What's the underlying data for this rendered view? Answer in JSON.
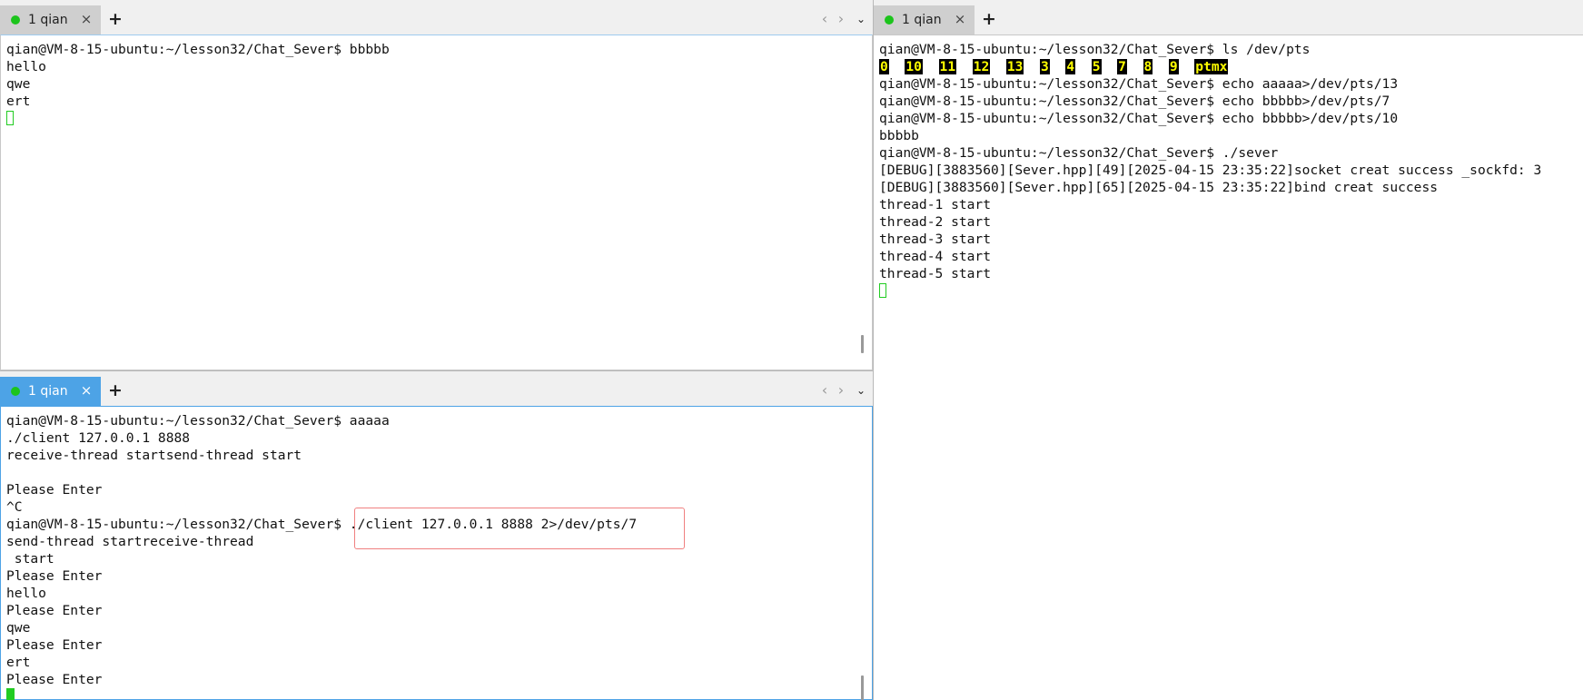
{
  "panes": {
    "top_left": {
      "tab_label": "1 qian",
      "lines": [
        "qian@VM-8-15-ubuntu:~/lesson32/Chat_Sever$ bbbbb",
        "hello",
        "qwe",
        "ert"
      ]
    },
    "bottom_left": {
      "tab_label": "1 qian",
      "lines": [
        "qian@VM-8-15-ubuntu:~/lesson32/Chat_Sever$ aaaaa",
        "./client 127.0.0.1 8888",
        "receive-thread startsend-thread start",
        "",
        "Please Enter",
        "^C",
        "qian@VM-8-15-ubuntu:~/lesson32/Chat_Sever$ ./client 127.0.0.1 8888 2>/dev/pts/7",
        "send-thread startreceive-thread",
        " start",
        "Please Enter",
        "hello",
        "Please Enter",
        "qwe",
        "Please Enter",
        "ert",
        "Please Enter"
      ]
    },
    "right": {
      "tab_label": "1 qian",
      "line_ls_cmd": "qian@VM-8-15-ubuntu:~/lesson32/Chat_Sever$ ls /dev/pts",
      "ls_items": [
        "0",
        "10",
        "11",
        "12",
        "13",
        "3",
        "4",
        "5",
        "7",
        "8",
        "9",
        "ptmx"
      ],
      "lines": [
        "qian@VM-8-15-ubuntu:~/lesson32/Chat_Sever$ echo aaaaa>/dev/pts/13",
        "qian@VM-8-15-ubuntu:~/lesson32/Chat_Sever$ echo bbbbb>/dev/pts/7",
        "qian@VM-8-15-ubuntu:~/lesson32/Chat_Sever$ echo bbbbb>/dev/pts/10",
        "bbbbb",
        "qian@VM-8-15-ubuntu:~/lesson32/Chat_Sever$ ./sever",
        "[DEBUG][3883560][Sever.hpp][49][2025-04-15 23:35:22]socket creat success _sockfd: 3",
        "[DEBUG][3883560][Sever.hpp][65][2025-04-15 23:35:22]bind creat success",
        "thread-1 start",
        "thread-2 start",
        "thread-3 start",
        "thread-4 start",
        "thread-5 start"
      ]
    }
  },
  "icons": {
    "close": "×",
    "add": "+",
    "prev": "‹",
    "next": "›",
    "dropdown": "⌄"
  },
  "colors": {
    "active_tab": "#4da3e6",
    "inactive_tab": "#cfcfcf",
    "status_dot": "#1cc41c",
    "cursor": "#22cc22",
    "ls_highlight_bg": "#000000",
    "ls_highlight_fg": "#ffff00",
    "annotation_box": "#f08080"
  }
}
